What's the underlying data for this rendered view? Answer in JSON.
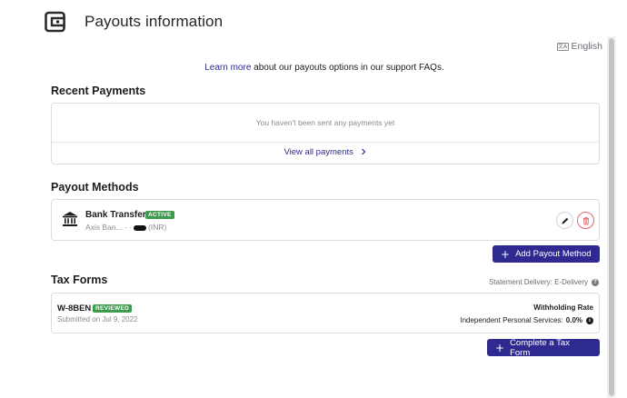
{
  "header": {
    "title": "Payouts information",
    "icon": "wallet-icon"
  },
  "language": {
    "label": "English",
    "icon": "translate-icon"
  },
  "support": {
    "link_text": "Learn more",
    "rest_text": " about our payouts options in our support FAQs."
  },
  "recent_payments": {
    "title": "Recent Payments",
    "empty_message": "You haven't been sent any payments yet",
    "view_all_label": "View all payments"
  },
  "payout_methods": {
    "title": "Payout Methods",
    "items": [
      {
        "name": "Bank Transfer",
        "status": "ACTIVE",
        "detail_prefix": "Axis Ban... · ·",
        "detail_suffix": "(INR)",
        "icon": "bank-icon"
      }
    ],
    "add_label": "Add Payout Method"
  },
  "tax_forms": {
    "title": "Tax Forms",
    "statement_delivery": "Statement Delivery: E-Delivery",
    "items": [
      {
        "name": "W-8BEN",
        "status": "REVIEWED",
        "submitted": "Submitted on Jul 9, 2022",
        "withholding_label": "Withholding Rate",
        "withholding_category": "Independent Personal Services:",
        "withholding_value": "0.0%"
      }
    ],
    "add_label": "Complete a Tax Form"
  },
  "colors": {
    "accent": "#2f2a8f",
    "link": "#2c2a8a",
    "badge_green": "#3d9a4f",
    "danger": "#e06666"
  }
}
